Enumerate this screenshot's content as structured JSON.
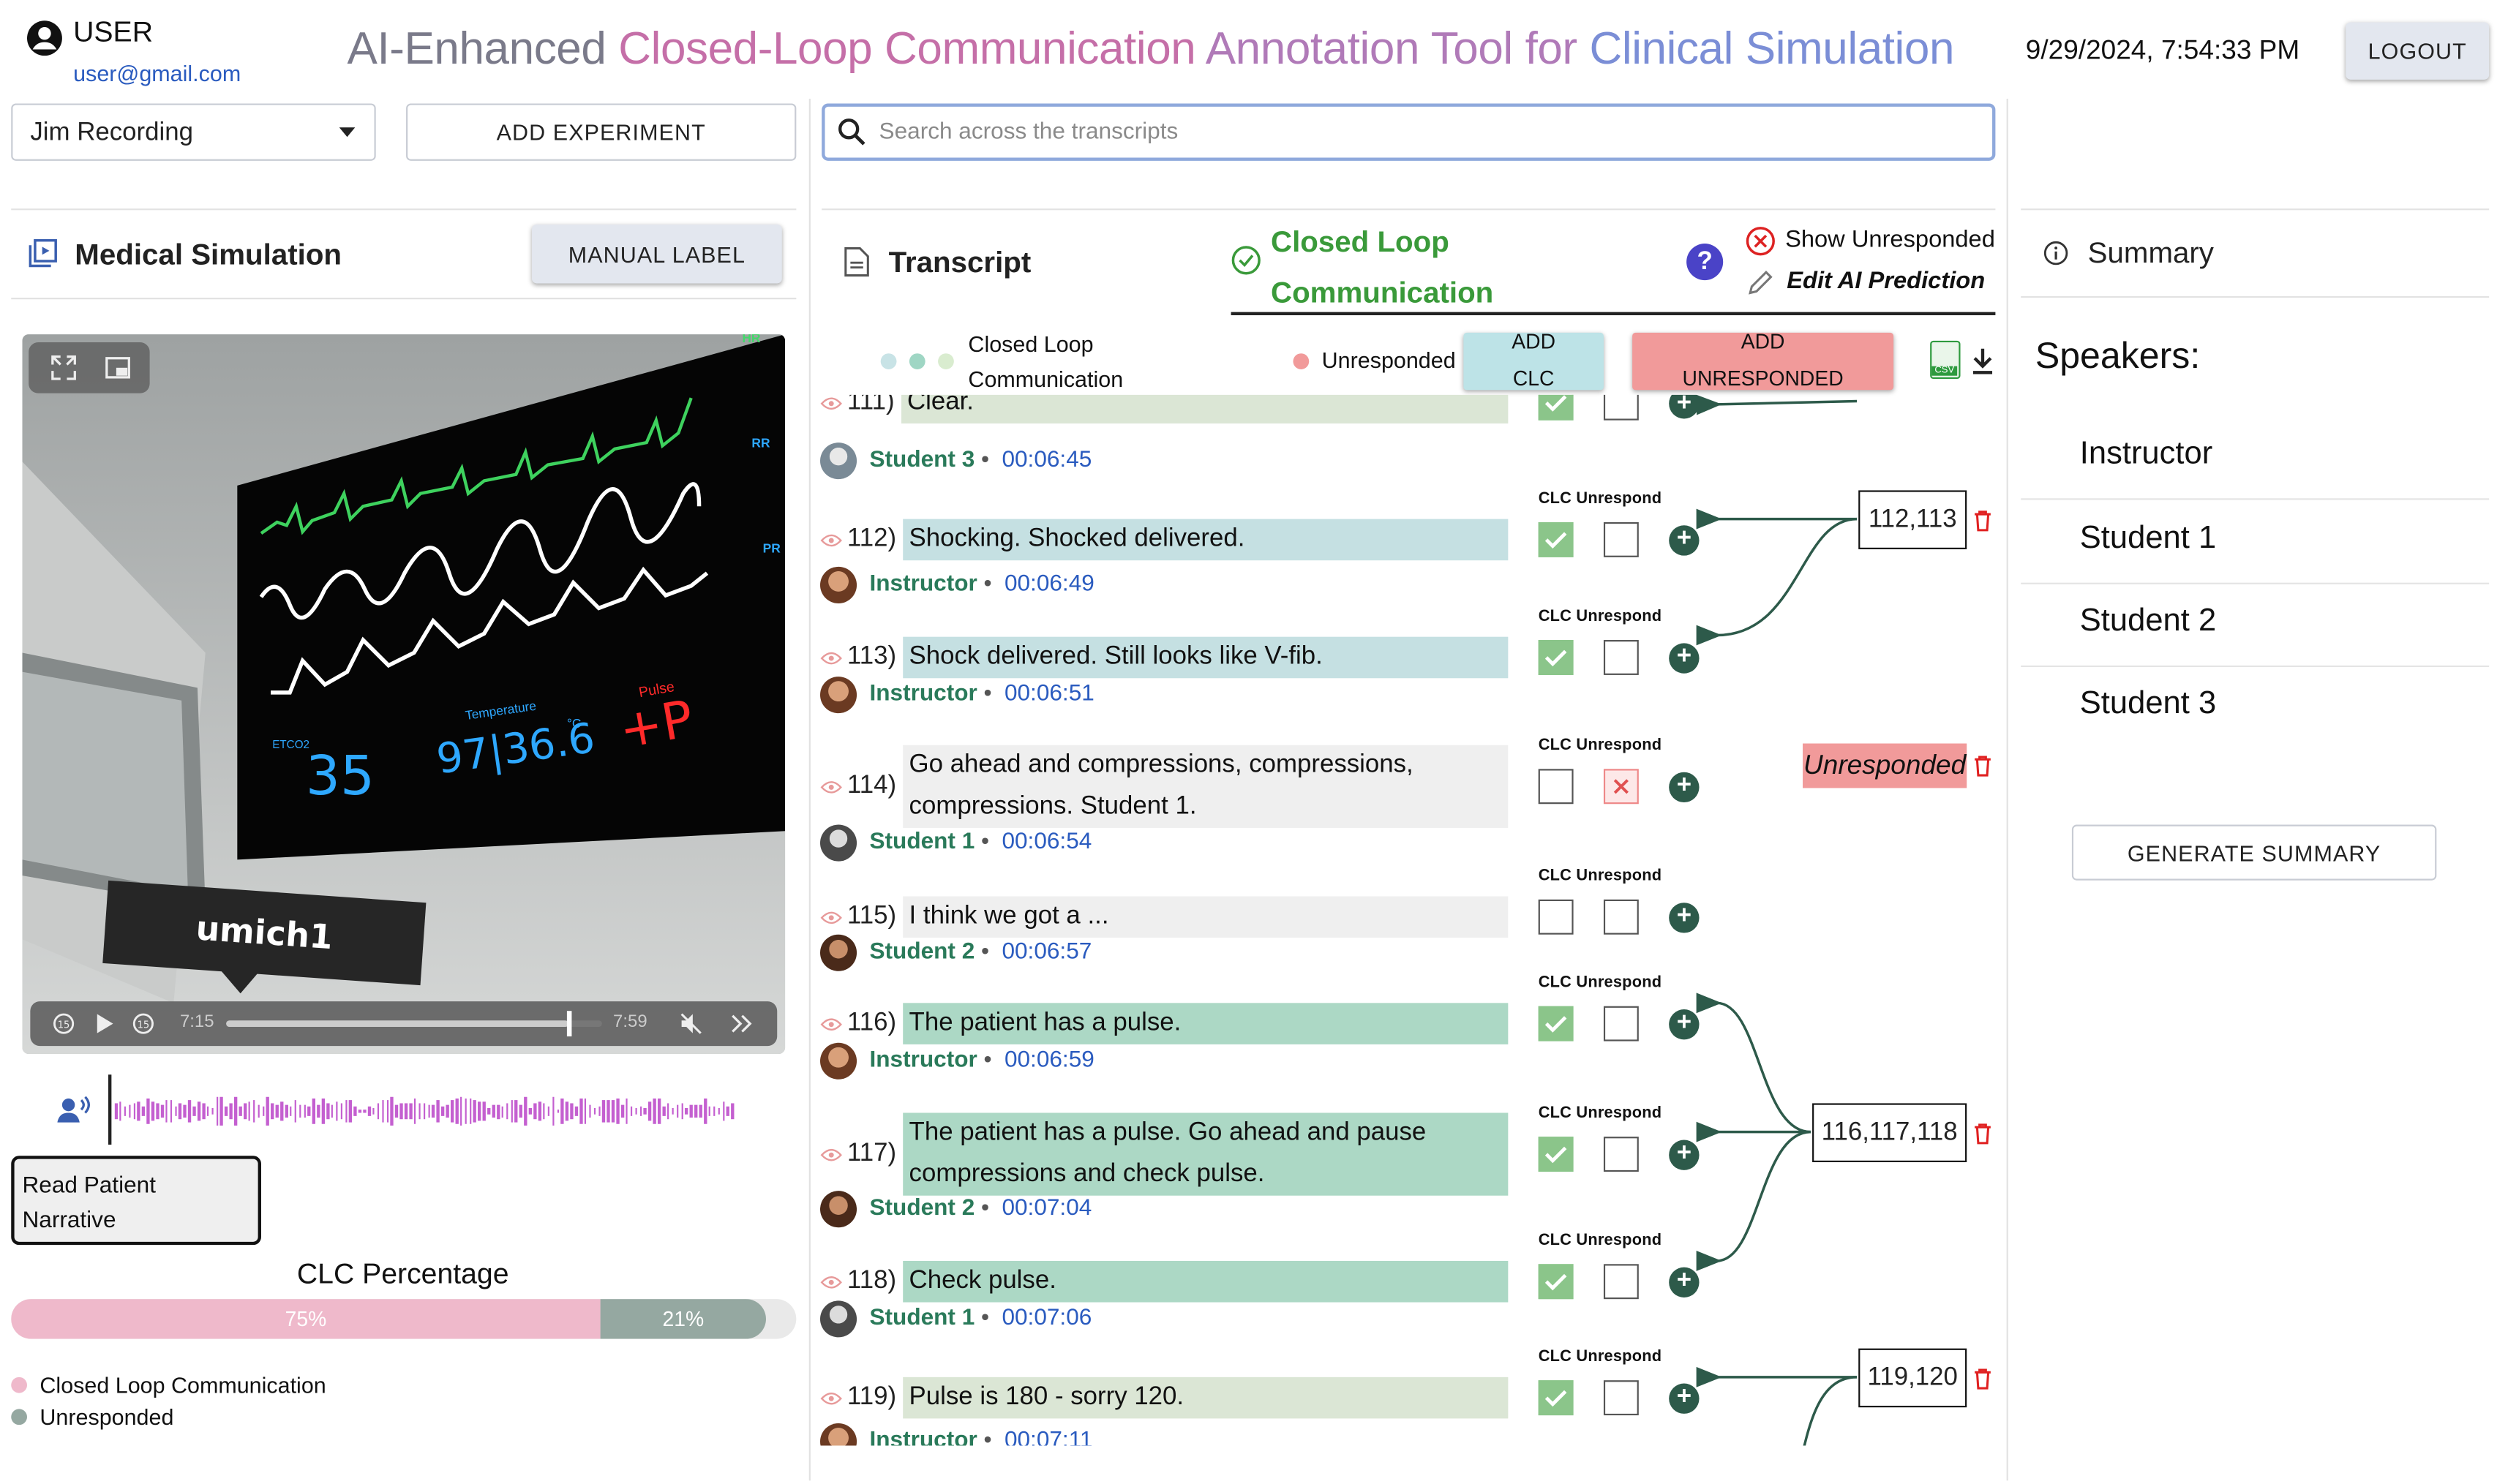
{
  "user": {
    "name": "USER",
    "email": "user@gmail.com"
  },
  "app_title": {
    "part1": "AI-Enhanced ",
    "part2": "Closed-Loop Communication",
    "part3": " Annotation Tool for ",
    "part4": "Clinical Simulation"
  },
  "datetime": "9/29/2024, 7:54:33 PM",
  "logout_label": "LOGOUT",
  "experiment_select": {
    "value": "Jim Recording"
  },
  "add_experiment_label": "ADD EXPERIMENT",
  "search": {
    "placeholder": "Search across the transcripts"
  },
  "video_panel": {
    "title": "Medical Simulation",
    "manual_label": "MANUAL LABEL",
    "monitor": {
      "etco2_label": "ETCO2",
      "etco2": "35",
      "temp_label": "Temperature",
      "temp": "97|36.6",
      "temp_unit": "°C",
      "pulse_label": "Pulse",
      "pulse": "+P",
      "hr": "HR",
      "rr": "RR",
      "pr": "PR"
    },
    "sign": "umich1",
    "current_time": "7:15",
    "duration": "7:59",
    "progress_fraction": 0.91
  },
  "narrative_button": "Read Patient Narrative",
  "clc_percentage": {
    "title": "CLC Percentage",
    "clc_pct_label": "75%",
    "unresp_pct_label": "21%",
    "clc_fraction": 0.75,
    "unresp_fraction": 0.21,
    "legend_clc": "Closed Loop Communication",
    "legend_unresp": "Unresponded",
    "clc_color": "#efb9cb",
    "unresp_color": "#95a8a1"
  },
  "transcript_tab": {
    "title": "Transcript",
    "clc_tab_line1": "Closed Loop",
    "clc_tab_line2": "Communication",
    "show_unresponded": "Show Unresponded",
    "edit_ai": "Edit AI Prediction",
    "legend_clc_line1": "Closed Loop",
    "legend_clc_line2": "Communication",
    "legend_unresp": "Unresponded",
    "add_clc_line1": "ADD",
    "add_clc_line2": "CLC",
    "add_unresp_line1": "ADD",
    "add_unresp_line2": "UNRESPONDED",
    "csv_label": "CSV",
    "col_clc": "CLC",
    "col_unresp": "Unrespond"
  },
  "transcript": {
    "partial_top": {
      "num": "111)",
      "text": "Clear."
    },
    "messages": [
      {
        "speaker": "Student 3",
        "time": "00:06:45",
        "num": "112)",
        "text": "Shocking. Shocked delivered.",
        "clc": true,
        "unresp": false,
        "color": "#c5e0e2"
      },
      {
        "speaker": "Instructor",
        "time": "00:06:49",
        "num": "113)",
        "text": "Shock delivered. Still looks like V-fib.",
        "clc": true,
        "unresp": false,
        "color": "#c5e0e2"
      },
      {
        "speaker": "Instructor",
        "time": "00:06:51",
        "num": "114)",
        "text": "Go ahead and compressions, compressions, compressions. Student 1.",
        "clc": false,
        "unresp": true,
        "color": "#efefef"
      },
      {
        "speaker": "Student 1",
        "time": "00:06:54",
        "num": "115)",
        "text": "I think we got a ...",
        "clc": false,
        "unresp": false,
        "color": "#efefef"
      },
      {
        "speaker": "Student 2",
        "time": "00:06:57",
        "num": "116)",
        "text": "The patient has a pulse.",
        "clc": true,
        "unresp": false,
        "color": "#acd8c5"
      },
      {
        "speaker": "Instructor",
        "time": "00:06:59",
        "num": "117)",
        "text": "The patient has a pulse. Go ahead and pause compressions and check pulse.",
        "clc": true,
        "unresp": false,
        "color": "#acd8c5"
      },
      {
        "speaker": "Student 2",
        "time": "00:07:04",
        "num": "118)",
        "text": "Check pulse.",
        "clc": true,
        "unresp": false,
        "color": "#acd8c5"
      },
      {
        "speaker": "Student 1",
        "time": "00:07:06",
        "num": "119)",
        "text": "Pulse is 180 - sorry 120.",
        "clc": true,
        "unresp": false,
        "color": "#dbe6d5"
      }
    ],
    "partial_bottom": {
      "speaker": "Instructor",
      "time": "00:07:11"
    },
    "groups": [
      "112,113",
      "116,117,118",
      "119,120"
    ],
    "unresponded_tag": "Unresponded"
  },
  "summary": {
    "tab_label": "Summary",
    "speakers_title": "Speakers:",
    "speakers": [
      "Instructor",
      "Student 1",
      "Student 2",
      "Student 3"
    ],
    "generate_label": "GENERATE SUMMARY"
  }
}
